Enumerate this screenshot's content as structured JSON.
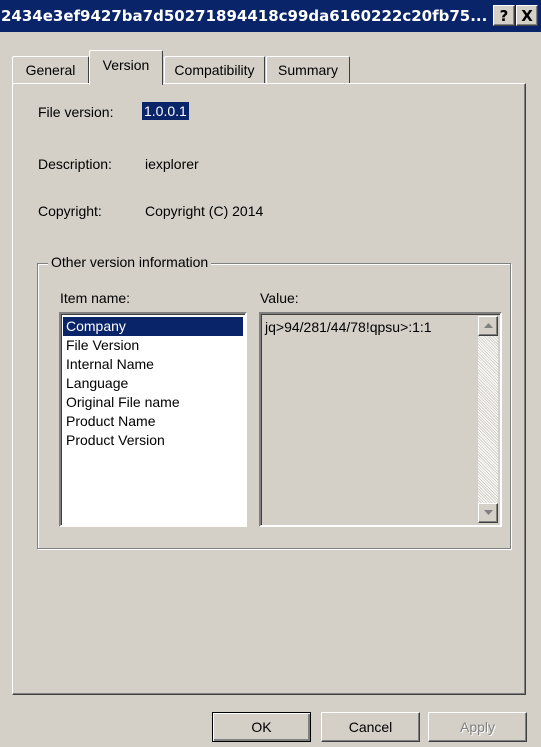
{
  "window": {
    "title": "2434e3ef9427ba7d50271894418c99da6160222c20fb75...",
    "help_label": "?",
    "close_label": "X"
  },
  "tabs": [
    {
      "label": "General"
    },
    {
      "label": "Version",
      "active": true
    },
    {
      "label": "Compatibility"
    },
    {
      "label": "Summary"
    }
  ],
  "version": {
    "file_version_label": "File version:",
    "file_version_value": "1.0.0.1",
    "description_label": "Description:",
    "description_value": "iexplorer",
    "copyright_label": "Copyright:",
    "copyright_value": "Copyright (C) 2014"
  },
  "other": {
    "group_label": "Other version information",
    "item_name_label": "Item name:",
    "value_label": "Value:",
    "items": [
      {
        "label": "Company",
        "selected": true
      },
      {
        "label": "File Version"
      },
      {
        "label": "Internal Name"
      },
      {
        "label": "Language"
      },
      {
        "label": "Original File name"
      },
      {
        "label": "Product Name"
      },
      {
        "label": "Product Version"
      }
    ],
    "value": "jq>94/281/44/78!qpsu>:1:1"
  },
  "buttons": {
    "ok": "OK",
    "cancel": "Cancel",
    "apply": "Apply"
  },
  "colors": {
    "titlebar": "#0a246a",
    "face": "#d4d0c8",
    "selection": "#0a246a"
  }
}
